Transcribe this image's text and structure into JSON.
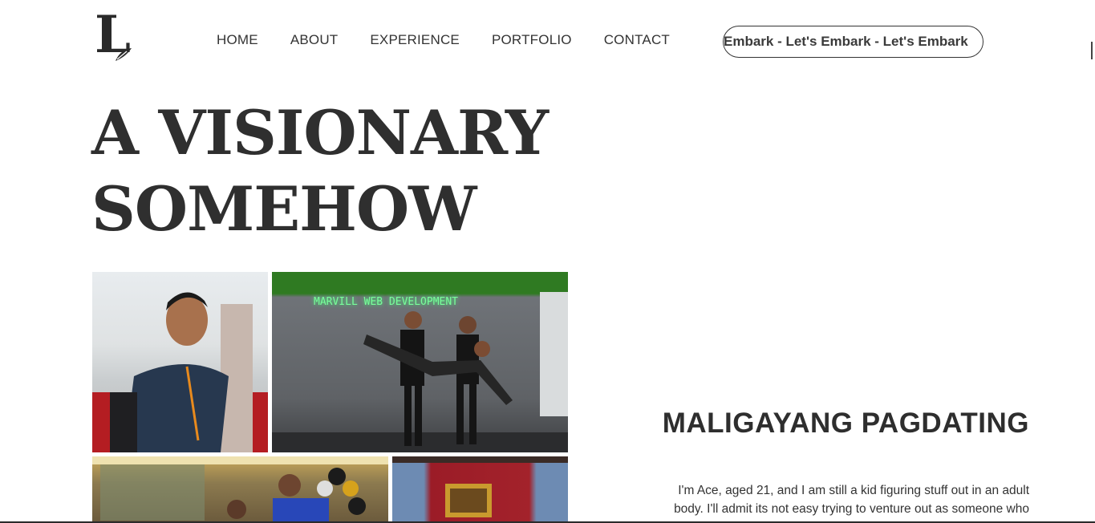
{
  "logo": {
    "letter": "L"
  },
  "nav": {
    "items": [
      "HOME",
      "ABOUT",
      "EXPERIENCE",
      "PORTFOLIO",
      "CONTACT"
    ]
  },
  "cta": {
    "label": "Embark - Let's Embark - Let's Embark"
  },
  "hero": {
    "line1": "A VISIONARY",
    "line2": "SOMEHOW"
  },
  "photos": {
    "p2_sign": "MARVILL WEB DEVELOPMENT"
  },
  "welcome": {
    "heading": "MALIGAYANG PAGDATING",
    "line1": "I'm Ace, aged 21, and I am still a kid figuring stuff out in an adult",
    "line2": "body. I'll admit its not easy trying to venture out as someone who"
  },
  "colors": {
    "text": "#2f2f2f",
    "background": "#ffffff"
  }
}
